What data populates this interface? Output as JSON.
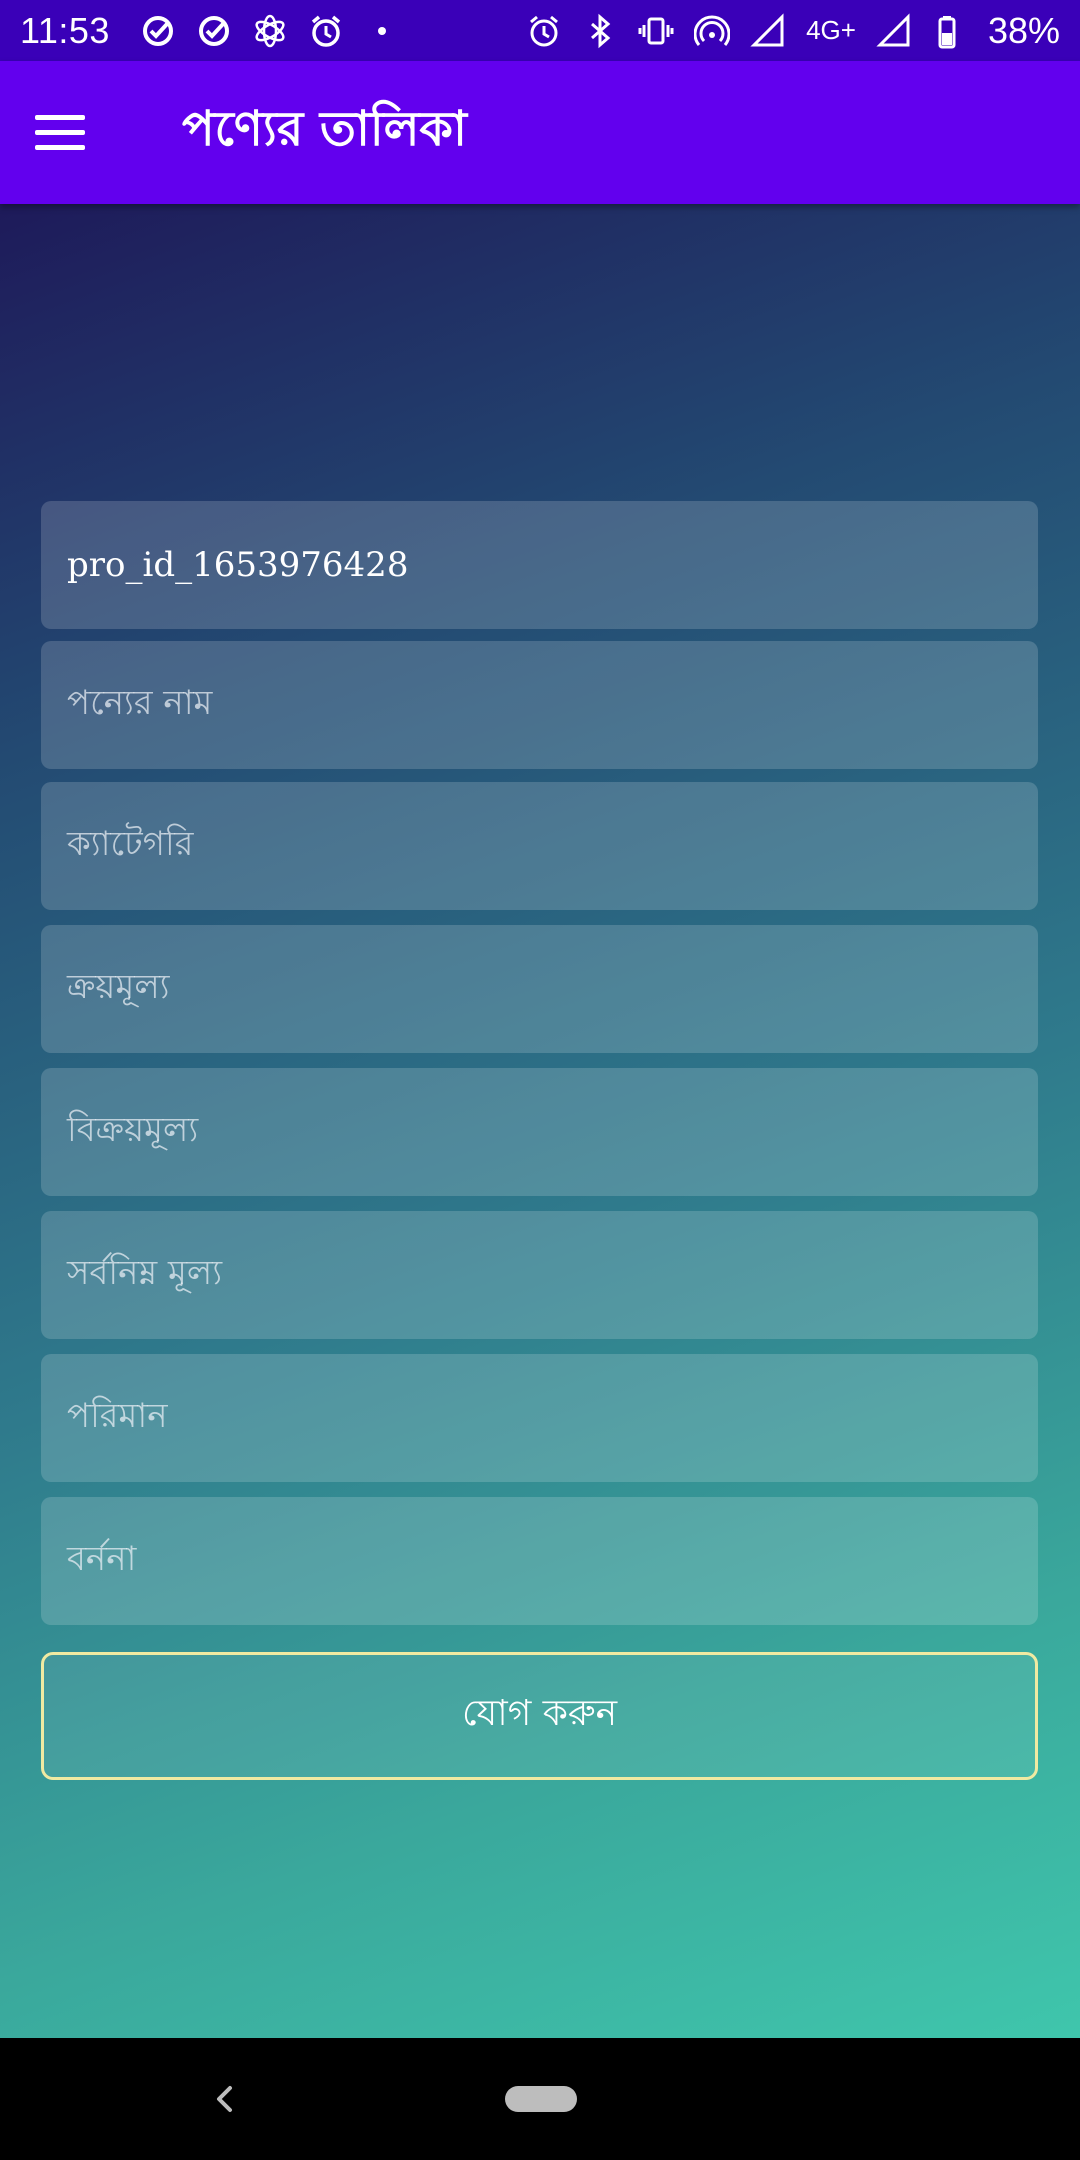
{
  "status_bar": {
    "time": "11:53",
    "left_icons": [
      "check-circle-icon",
      "check-circle-icon",
      "settings-flower-icon",
      "alarm-icon",
      "dot-icon"
    ],
    "right_icons": [
      "alarm-icon",
      "bluetooth-icon",
      "vibrate-icon",
      "hotspot-icon",
      "signal-icon",
      "signal-icon",
      "battery-icon"
    ],
    "network": "4G+",
    "battery": "38%"
  },
  "app_bar": {
    "title": "পণ্যের তালিকা",
    "menu_icon": "hamburger-menu-icon"
  },
  "form": {
    "product_id": "pro_id_1653976428",
    "product_name_placeholder": "পন্যের নাম",
    "category_placeholder": "ক্যাটেগরি",
    "purchase_price_placeholder": "ক্রয়মূল্য",
    "selling_price_placeholder": "বিক্রয়মূল্য",
    "minimum_price_placeholder": "সর্বনিম্ন মূল্য",
    "quantity_placeholder": "পরিমান",
    "description_placeholder": "বর্ননা",
    "submit_label": "যোগ করুন"
  },
  "colors": {
    "status_bar": "#3a00b8",
    "app_bar": "#6200ee",
    "button_border": "#f0eaa2",
    "gradient_start": "#1e1a5a",
    "gradient_end": "#3fc6ac"
  }
}
